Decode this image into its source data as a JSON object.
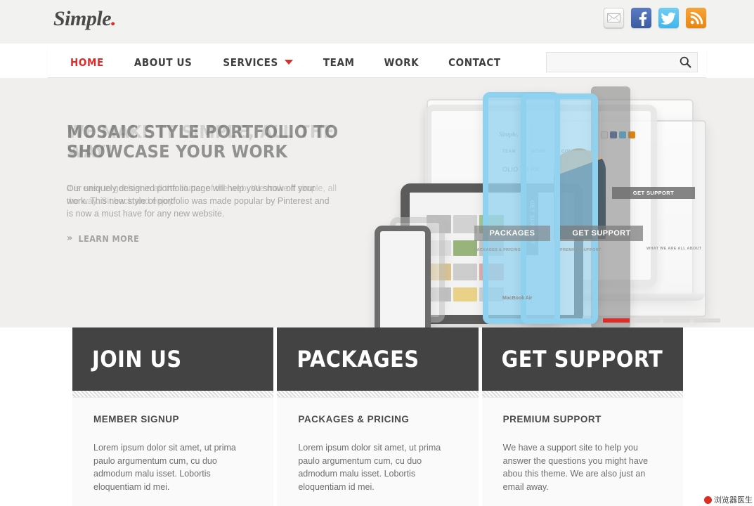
{
  "brand": {
    "name": "Simple",
    "dot": "."
  },
  "social": [
    {
      "name": "email-icon",
      "label": "Email",
      "color": "#efefef"
    },
    {
      "name": "facebook-icon",
      "label": "Facebook",
      "color": "#3b5ca0"
    },
    {
      "name": "twitter-icon",
      "label": "Twitter",
      "color": "#3fb6ea"
    },
    {
      "name": "rss-icon",
      "label": "RSS",
      "color": "#e8860f"
    }
  ],
  "nav": {
    "items": [
      {
        "label": "HOME",
        "active": true
      },
      {
        "label": "ABOUT US",
        "active": false
      },
      {
        "label": "SERVICES",
        "active": false,
        "caret": true
      },
      {
        "label": "TEAM",
        "active": false
      },
      {
        "label": "WORK",
        "active": false
      },
      {
        "label": "CONTACT",
        "active": false
      }
    ],
    "active_color": "#e02b2b",
    "text_color": "#3f3f3f"
  },
  "search": {
    "value": "",
    "placeholder": ""
  },
  "slider": {
    "current_slide_headline": "MOSAIC STYLE PORTFOLIO TO SHOWCASE YOUR WORK",
    "current_slide_body": "Our uniquely designed portfolio page will help you show off your work. This new style of portfolio was made popular by Pinterest and is now a must have for any new website.",
    "outgoing_slide_headline": "WE MAKE IT SIMPLE, ALL THE WAY!",
    "outgoing_slide_body": "It is easy to get lost in all the clutter of the web. We make it simple, all the way. Sit back and enjoy!",
    "cta_label": "LEARN MORE",
    "cta_icon": "»",
    "pagination": {
      "total": 4,
      "active_index": 0,
      "active_color": "#e02b2b",
      "inactive_color": "#dcdcdc"
    },
    "mockup": {
      "logo": "Simple.",
      "nav": [
        "TEAM",
        "WORK",
        "CONTACT"
      ],
      "hero": "OLIO TO RK",
      "buttons": [
        "GET SUPPORT",
        "PACKAGES",
        "GET SUPPORT"
      ],
      "subheads": [
        "PACKAGES & PRICING",
        "PREMIUM SUPPORT",
        "WHAT WE ARE ALL ABOUT"
      ],
      "vertical_tab": "GET SUPPORT",
      "caption": "MacBook Air"
    }
  },
  "boxes": [
    {
      "title": "JOIN US",
      "subtitle": "MEMBER SIGNUP",
      "text": "Lorem ipsum dolor sit amet, ut prima paulo argumentum cum, cu duo admodum malu isset. Lobortis eloquentiam id mei."
    },
    {
      "title": "PACKAGES",
      "subtitle": "PACKAGES & PRICING",
      "text": "Lorem ipsum dolor sit amet, ut prima paulo argumentum cum, cu duo admodum malu isset. Lobortis eloquentiam id mei."
    },
    {
      "title": "GET SUPPORT",
      "subtitle": "PREMIUM SUPPORT",
      "text": "We have a support site to help you answer the questions you might have abou this theme. We are also just an email away."
    }
  ],
  "watermark": {
    "text": "浏览器医生"
  }
}
